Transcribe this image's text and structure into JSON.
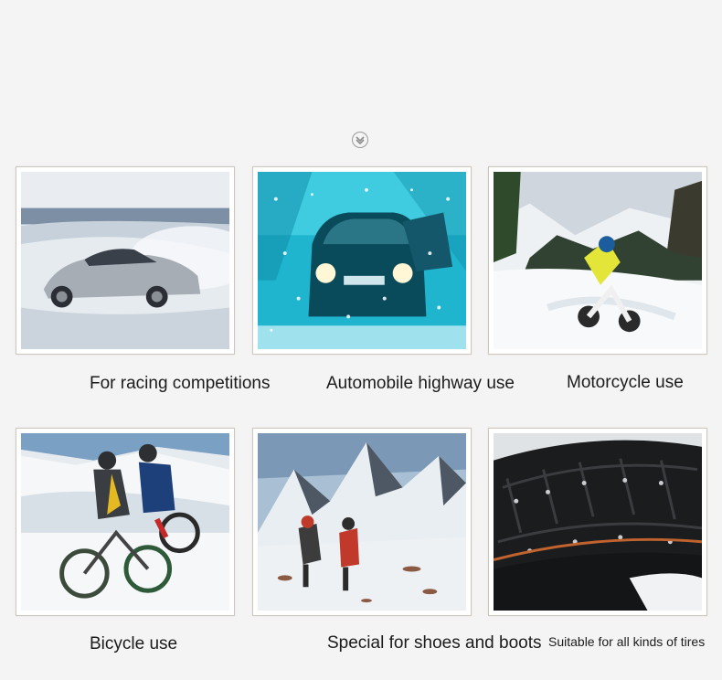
{
  "tiles": [
    {
      "caption": "For racing competitions"
    },
    {
      "caption": "Automobile highway use"
    },
    {
      "caption": "Motorcycle use"
    },
    {
      "caption": "Bicycle use"
    },
    {
      "caption": "Special for shoes and boots"
    },
    {
      "caption": "Suitable for all kinds of tires"
    }
  ],
  "icons": {
    "section_toggle": "chevron-down-icon"
  }
}
